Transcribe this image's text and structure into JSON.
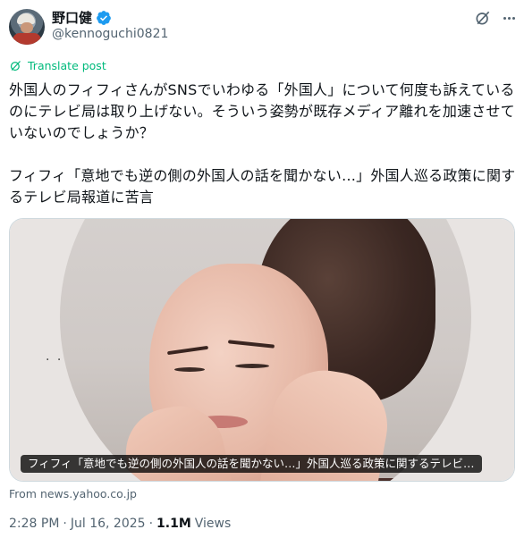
{
  "author": {
    "display_name": "野口健",
    "handle": "@kennoguchi0821",
    "verified": true,
    "verified_color": "#1d9bf0"
  },
  "translate_label": "Translate post",
  "accent_green": "#00ba7c",
  "post": {
    "paragraph1": "外国人のフィフィさんがSNSでいわゆる「外国人」について何度も訴えているのにテレビ局は取り上げない。そういう姿勢が既存メディア離れを加速させていないのでしょうか？",
    "paragraph2": "フィフィ「意地でも逆の側の外国人の話を聞かない…」外国人巡る政策に関するテレビ局報道に苦言"
  },
  "card": {
    "caption": "フィフィ「意地でも逆の側の外国人の話を聞かない…」外国人巡る政策に関するテレビ…",
    "source": "From news.yahoo.co.jp"
  },
  "meta": {
    "time": "2:28 PM",
    "separator1": "·",
    "date": "Jul 16, 2025",
    "separator2": "·",
    "views_count": "1.1M",
    "views_label": "Views"
  },
  "icons": {
    "grok": "grok-icon",
    "more": "more-icon",
    "translate": "translate-icon",
    "verified": "verified-badge-icon"
  }
}
